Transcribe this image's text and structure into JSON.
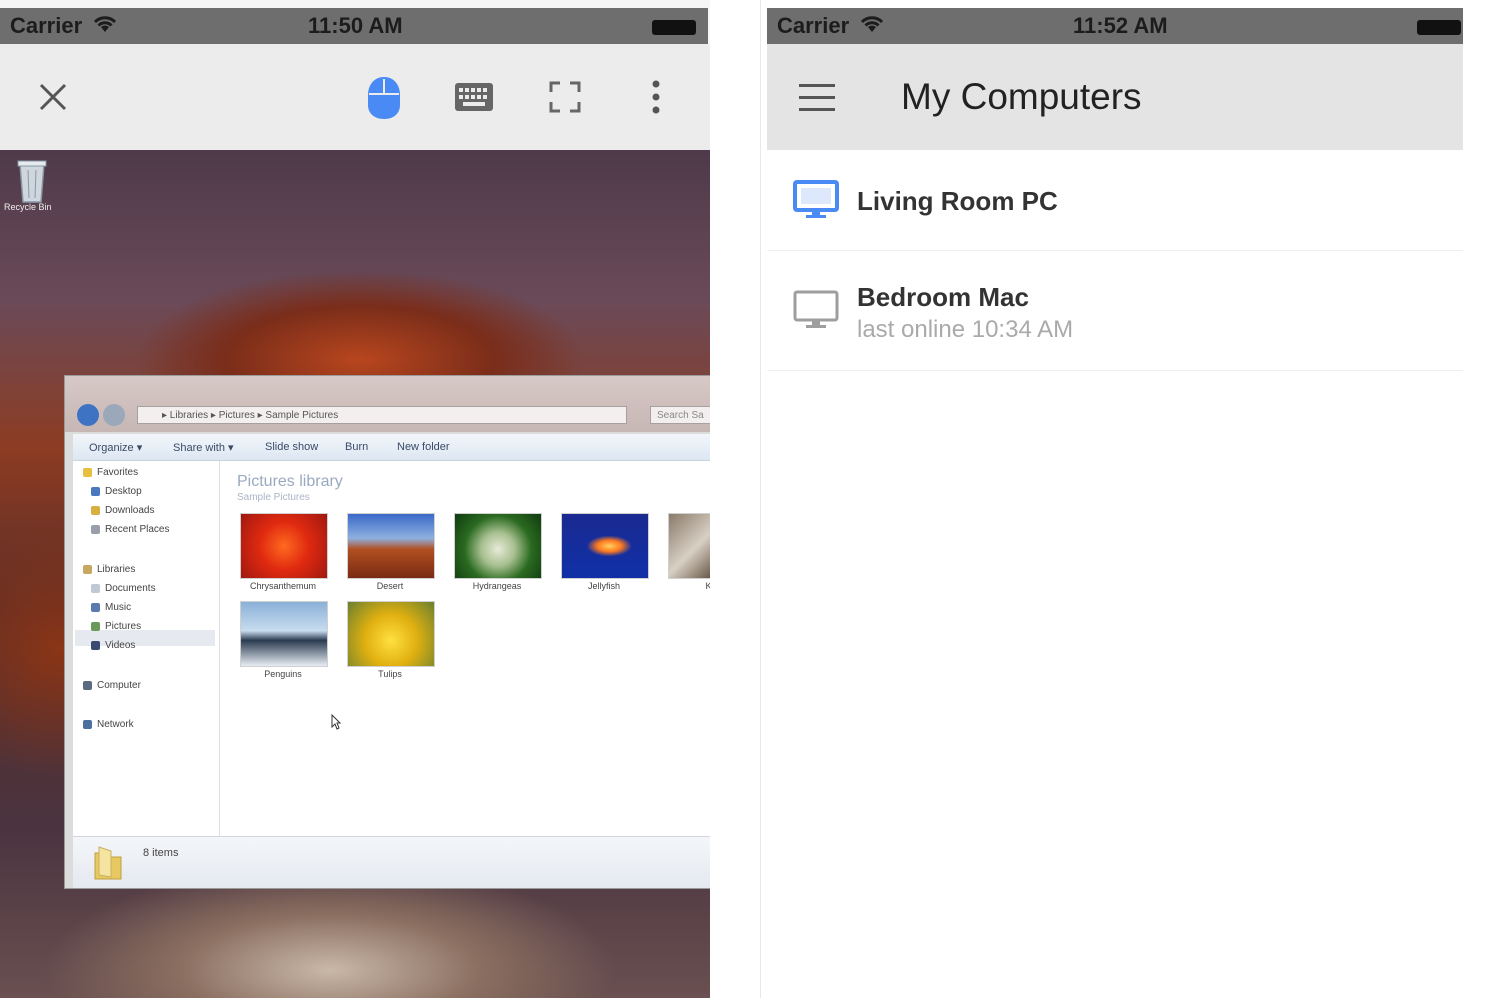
{
  "left_phone": {
    "status_bar": {
      "carrier": "Carrier",
      "time": "11:50 AM"
    },
    "toolbar": {
      "close_icon": "close-icon",
      "mouse_icon": "mouse-icon",
      "keyboard_icon": "keyboard-icon",
      "fullscreen_icon": "fullscreen-icon",
      "more_icon": "more-vertical-icon",
      "accent_color": "#4a8af4"
    },
    "desktop": {
      "recycle_bin_label": "Recycle Bin",
      "explorer": {
        "address": "▸ Libraries ▸ Pictures ▸ Sample Pictures",
        "search_placeholder": "Search Sa",
        "commands": [
          "Organize ▾",
          "Share with ▾",
          "Slide show",
          "Burn",
          "New folder"
        ],
        "nav": {
          "favorites": "Favorites",
          "desktop": "Desktop",
          "downloads": "Downloads",
          "recent_places": "Recent Places",
          "libraries": "Libraries",
          "documents": "Documents",
          "music": "Music",
          "pictures": "Pictures",
          "videos": "Videos",
          "computer": "Computer",
          "network": "Network"
        },
        "library_title": "Pictures library",
        "library_subtitle": "Sample Pictures",
        "pictures": [
          {
            "label": "Chrysanthemum"
          },
          {
            "label": "Desert"
          },
          {
            "label": "Hydrangeas"
          },
          {
            "label": "Jellyfish"
          },
          {
            "label": "Ko"
          },
          {
            "label": "Penguins"
          },
          {
            "label": "Tulips"
          }
        ],
        "items_count": "8 items"
      }
    }
  },
  "right_phone": {
    "status_bar": {
      "carrier": "Carrier",
      "time": "11:52 AM"
    },
    "header": {
      "menu_icon": "hamburger-menu-icon",
      "title": "My Computers"
    },
    "computers": [
      {
        "name": "Living Room PC",
        "status": "",
        "online": true,
        "icon_color": "#4a8af4"
      },
      {
        "name": "Bedroom Mac",
        "status": "last online 10:34 AM",
        "online": false,
        "icon_color": "#9e9e9e"
      }
    ]
  }
}
